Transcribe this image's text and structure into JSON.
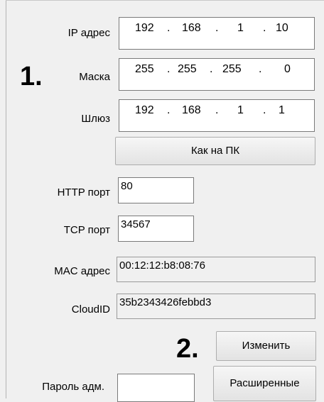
{
  "labels": {
    "ip": "IP адрес",
    "mask": "Маска",
    "gateway": "Шлюз",
    "http_port": "HTTP порт",
    "tcp_port": "TCP порт",
    "mac": "MAC адрес",
    "cloud_id": "CloudID",
    "admin_password": "Пароль адм."
  },
  "ip_address": {
    "octets": [
      "192",
      "168",
      "1",
      "10"
    ]
  },
  "mask": {
    "octets": [
      "255",
      "255",
      "255",
      "0"
    ]
  },
  "gateway": {
    "octets": [
      "192",
      "168",
      "1",
      "1"
    ]
  },
  "separator": ".",
  "fields": {
    "http_port": "80",
    "tcp_port": "34567",
    "mac": "00:12:12:b8:08:76",
    "cloud_id": "35b2343426febbd3",
    "admin_password": ""
  },
  "buttons": {
    "like_pc": "Как на ПК",
    "change": "Изменить",
    "advanced": "Расширенные"
  },
  "markers": {
    "one": "1.",
    "two": "2."
  }
}
